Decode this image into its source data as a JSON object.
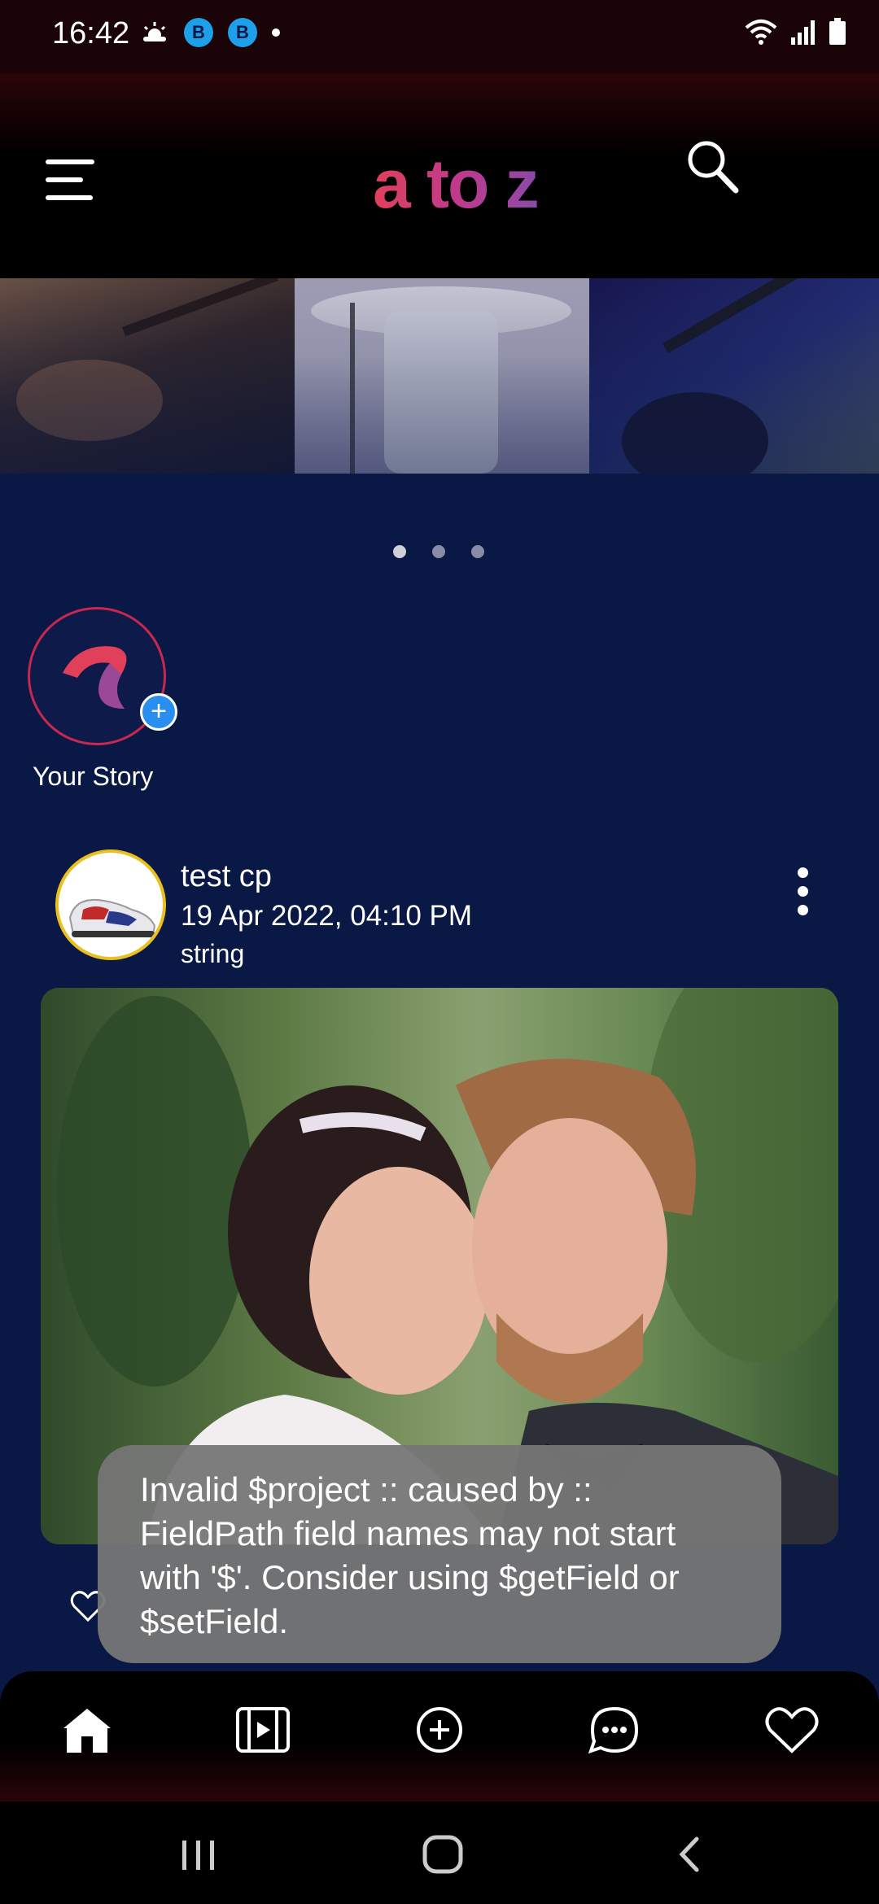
{
  "status_bar": {
    "time": "16:42",
    "icons": [
      "weather-icon",
      "b-badge-icon",
      "b-badge-icon",
      "dot-icon"
    ],
    "right_icons": [
      "wifi-icon",
      "signal-icon",
      "battery-icon"
    ],
    "badge_letter": "B"
  },
  "header": {
    "logo": "a to z",
    "menu_icon": "hamburger-icon",
    "search_icon": "search-icon"
  },
  "carousel": {
    "slide_count": 3,
    "active_index": 0
  },
  "story": {
    "label": "Your Story",
    "add_symbol": "+"
  },
  "post": {
    "username": "test cp",
    "date": "19 Apr 2022, 04:10 PM",
    "caption": "string",
    "actions": [
      "heart-outline-icon"
    ]
  },
  "toast": {
    "message": "Invalid $project :: caused by :: FieldPath field names may not start with '$'. Consider using $getField or $setField."
  },
  "bottom_nav": {
    "items": [
      "home-icon",
      "reels-icon",
      "add-post-icon",
      "messages-icon",
      "favorites-icon"
    ],
    "active": "home-icon"
  },
  "system_nav": [
    "recents-icon",
    "home-circle-icon",
    "back-icon"
  ],
  "colors": {
    "background": "#0a1845",
    "logo_gradient": [
      "#e0405a",
      "#8a4aa8"
    ],
    "story_ring": "#c8284f",
    "plus_badge": "#2a8ef0",
    "avatar_ring": "#e8c020"
  }
}
